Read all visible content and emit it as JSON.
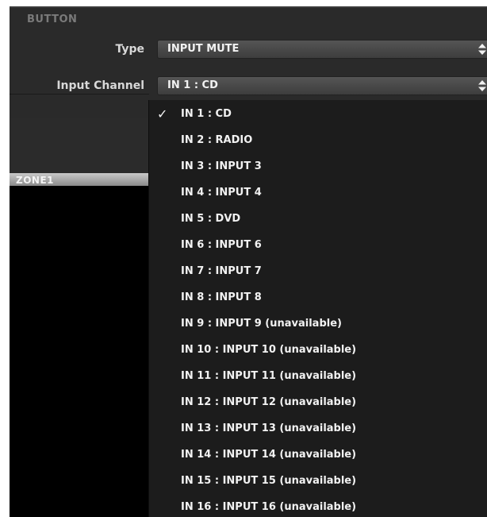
{
  "section_title": "BUTTON",
  "type_label": "Type",
  "type_value": "INPUT MUTE",
  "channel_label": "Input Channel",
  "channel_value": "IN 1 : CD",
  "zone_label": "ZONE1",
  "checkmark": "✓",
  "options": [
    {
      "label": "IN 1 : CD",
      "selected": true
    },
    {
      "label": "IN 2 : RADIO",
      "selected": false
    },
    {
      "label": "IN 3 : INPUT 3",
      "selected": false
    },
    {
      "label": "IN 4 : INPUT 4",
      "selected": false
    },
    {
      "label": "IN 5 : DVD",
      "selected": false
    },
    {
      "label": "IN 6 : INPUT 6",
      "selected": false
    },
    {
      "label": "IN 7 : INPUT 7",
      "selected": false
    },
    {
      "label": "IN 8 : INPUT 8",
      "selected": false
    },
    {
      "label": "IN 9 : INPUT 9 (unavailable)",
      "selected": false
    },
    {
      "label": "IN 10 : INPUT 10 (unavailable)",
      "selected": false
    },
    {
      "label": "IN 11 : INPUT 11 (unavailable)",
      "selected": false
    },
    {
      "label": "IN 12 : INPUT 12 (unavailable)",
      "selected": false
    },
    {
      "label": "IN 13 : INPUT 13 (unavailable)",
      "selected": false
    },
    {
      "label": "IN 14 : INPUT 14 (unavailable)",
      "selected": false
    },
    {
      "label": "IN 15 : INPUT 15 (unavailable)",
      "selected": false
    },
    {
      "label": "IN 16 : INPUT 16 (unavailable)",
      "selected": false
    }
  ],
  "colors": {
    "panel": "#2a2a2a",
    "dropdown": "#1c1c1c",
    "text": "#f2f2f2",
    "section_title": "#7a7a7a"
  }
}
